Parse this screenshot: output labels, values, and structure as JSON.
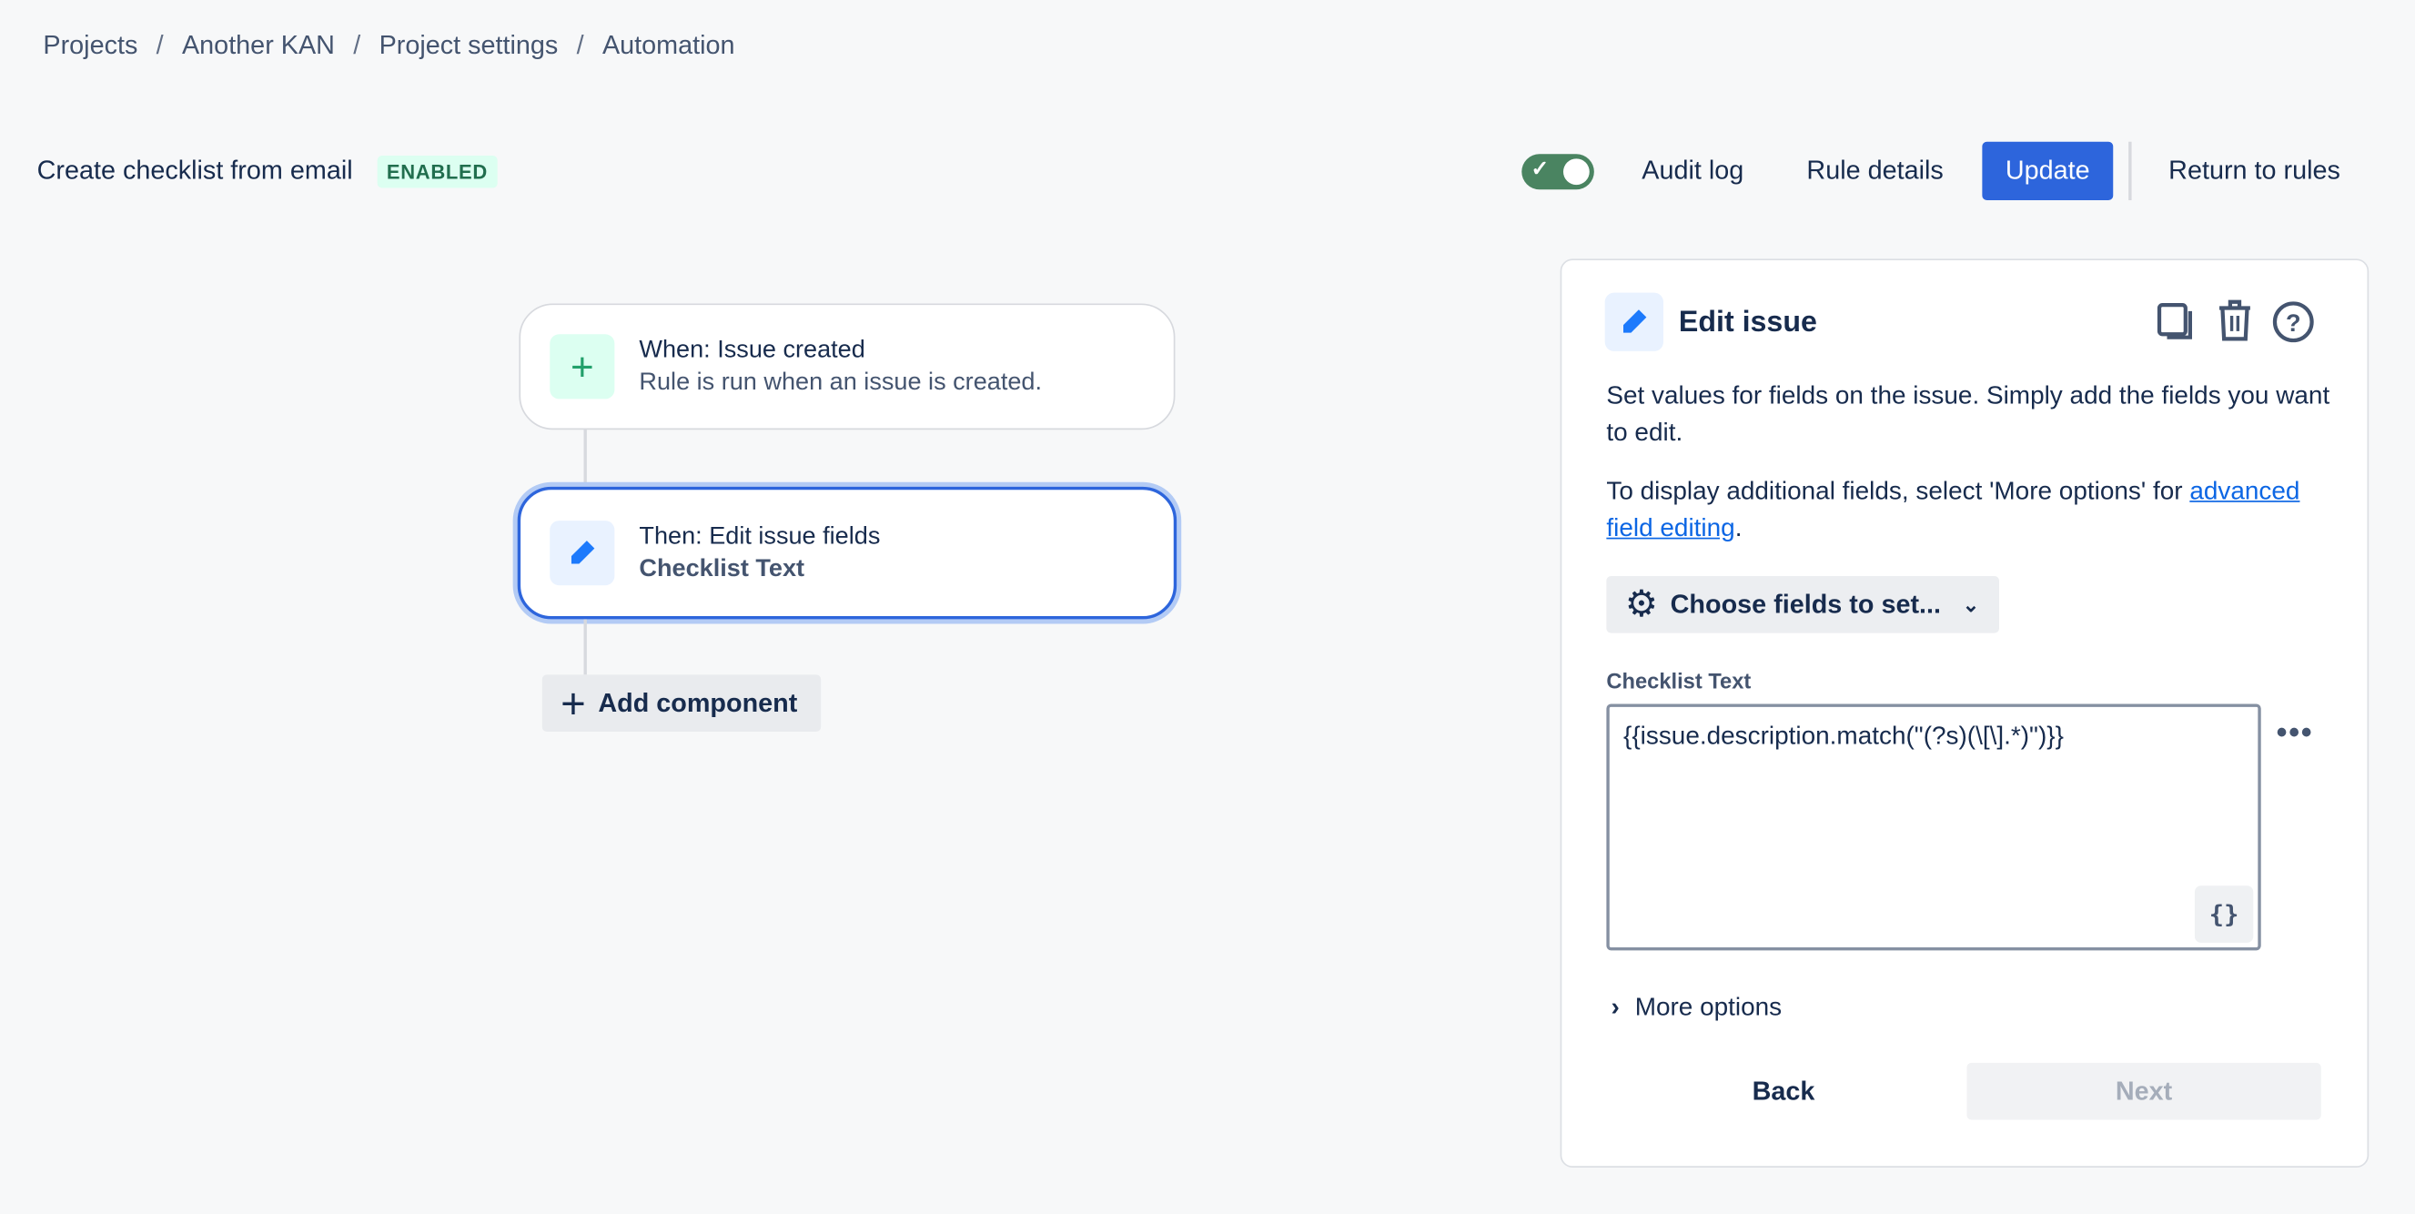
{
  "breadcrumb": [
    "Projects",
    "Another KAN",
    "Project settings",
    "Automation"
  ],
  "header": {
    "rule_name": "Create checklist from email",
    "status_badge": "ENABLED",
    "enabled": true,
    "audit_log": "Audit log",
    "rule_details": "Rule details",
    "update": "Update",
    "return": "Return to rules"
  },
  "flow": {
    "trigger": {
      "title": "When: Issue created",
      "subtitle": "Rule is run when an issue is created.",
      "icon": "plus-icon"
    },
    "action": {
      "title": "Then: Edit issue fields",
      "subtitle": "Checklist Text",
      "icon": "pencil-icon"
    },
    "add_component": "Add component"
  },
  "panel": {
    "title": "Edit issue",
    "desc1": "Set values for fields on the issue. Simply add the fields you want to edit.",
    "desc2_prefix": "To display additional fields, select 'More options' for ",
    "desc2_link": "advanced field editing",
    "desc2_suffix": ".",
    "choose_fields": "Choose fields to set...",
    "field_label": "Checklist Text",
    "field_value": "{{issue.description.match(\"(?s)(\\[\\].*)\")}}",
    "smart_value_button": "{}",
    "more_options": "More options",
    "back": "Back",
    "next": "Next"
  },
  "colors": {
    "primary": "#2d65dc",
    "toggle_on": "#4a8461",
    "badge_bg": "#dcfff1"
  }
}
